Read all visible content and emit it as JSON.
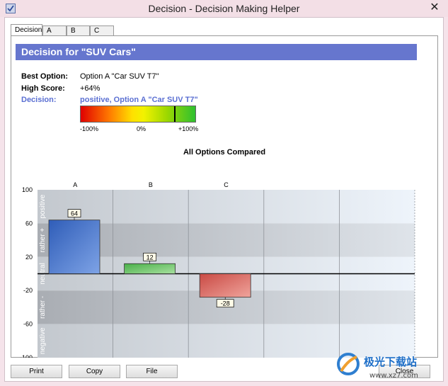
{
  "window": {
    "title": "Decision - Decision Making Helper",
    "close_glyph": "✕"
  },
  "tabs": [
    {
      "label": "Decision",
      "active": true
    },
    {
      "label": "A",
      "active": false
    },
    {
      "label": "B",
      "active": false
    },
    {
      "label": "C",
      "active": false
    }
  ],
  "header": {
    "title": "Decision for  \"SUV Cars\"",
    "color": "#6676ce"
  },
  "summary": {
    "best_option_label": "Best Option:",
    "best_option_value": "Option A \"Car SUV T7\"",
    "high_score_label": "High Score:",
    "high_score_value": "+64%",
    "decision_label": "Decision:",
    "decision_value": "positive, Option A \"Car SUV T7\""
  },
  "gauge": {
    "value_percent": 64,
    "min_label": "-100%",
    "mid_label": "0%",
    "max_label": "+100%"
  },
  "chart_data": {
    "type": "bar",
    "title": "All Options Compared",
    "categories": [
      "A",
      "B",
      "C",
      "",
      ""
    ],
    "values": [
      64,
      12,
      -28
    ],
    "data_labels": [
      "64",
      "12",
      "-28"
    ],
    "bar_colors": [
      "#4a72c8",
      "#6cc46c",
      "#e06a64"
    ],
    "ylim": [
      -100,
      100
    ],
    "yticks": [
      100,
      60,
      20,
      -20,
      -60,
      -100
    ],
    "bands": [
      {
        "label": "positive",
        "from": 100,
        "to": 60
      },
      {
        "label": "rather +",
        "from": 60,
        "to": 20
      },
      {
        "label": "neutral",
        "from": 20,
        "to": -20
      },
      {
        "label": "rather -",
        "from": -20,
        "to": -60
      },
      {
        "label": "negative",
        "from": -60,
        "to": -100
      }
    ]
  },
  "buttons": {
    "print": "Print",
    "copy": "Copy",
    "file": "File",
    "close": "Close"
  },
  "watermark": {
    "text": "极光下载站",
    "url_text": "www.xz7.com"
  }
}
